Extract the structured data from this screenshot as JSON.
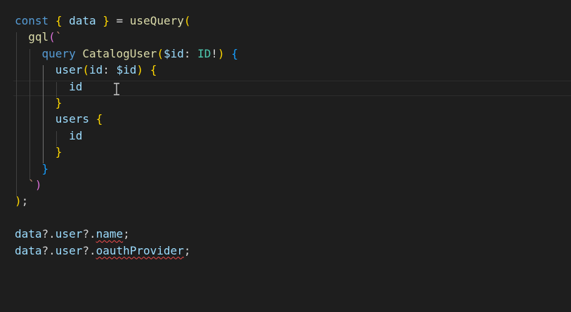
{
  "editor": {
    "language": "javascript",
    "theme": "dark",
    "colors": {
      "background": "#1e1e1e",
      "keyword": "#569cd6",
      "variable": "#9cdcfe",
      "function": "#dcdcaa",
      "type": "#4ec9b0",
      "bracket1": "#ffd700",
      "bracket2": "#da70d6",
      "bracket3": "#179fff",
      "punctuation": "#d4d4d4",
      "error_squiggle": "#f14c4c"
    },
    "cursor": {
      "icon": "text-cursor-ibeam-icon",
      "line": 5
    },
    "lines": [
      [
        [
          "const",
          "#569cd6"
        ],
        [
          " ",
          "#d4d4d4"
        ],
        [
          "{",
          "#ffd700"
        ],
        [
          " data ",
          "#9cdcfe"
        ],
        [
          "}",
          "#ffd700"
        ],
        [
          " = ",
          "#d4d4d4"
        ],
        [
          "useQuery",
          "#dcdcaa"
        ],
        [
          "(",
          "#ffd700"
        ]
      ],
      [
        [
          "  ",
          "#d4d4d4"
        ],
        [
          "gql",
          "#dcdcaa"
        ],
        [
          "(",
          "#da70d6"
        ],
        [
          "`",
          "#ce9178"
        ]
      ],
      [
        [
          "    ",
          "#d4d4d4"
        ],
        [
          "query",
          "#569cd6"
        ],
        [
          " ",
          "#d4d4d4"
        ],
        [
          "CatalogUser",
          "#dcdcaa"
        ],
        [
          "(",
          "#ffd700"
        ],
        [
          "$id",
          "#9cdcfe"
        ],
        [
          ": ",
          "#d4d4d4"
        ],
        [
          "ID",
          "#4ec9b0"
        ],
        [
          "!",
          "#d4d4d4"
        ],
        [
          ")",
          "#ffd700"
        ],
        [
          " ",
          "#d4d4d4"
        ],
        [
          "{",
          "#179fff"
        ]
      ],
      [
        [
          "      ",
          "#d4d4d4"
        ],
        [
          "user",
          "#9cdcfe"
        ],
        [
          "(",
          "#ffd700"
        ],
        [
          "id",
          "#9cdcfe"
        ],
        [
          ": ",
          "#d4d4d4"
        ],
        [
          "$id",
          "#9cdcfe"
        ],
        [
          ")",
          "#ffd700"
        ],
        [
          " ",
          "#d4d4d4"
        ],
        [
          "{",
          "#ffd700"
        ]
      ],
      [
        [
          "        ",
          "#d4d4d4"
        ],
        [
          "id",
          "#9cdcfe"
        ]
      ],
      [
        [
          "      ",
          "#d4d4d4"
        ],
        [
          "}",
          "#ffd700"
        ]
      ],
      [
        [
          "      ",
          "#d4d4d4"
        ],
        [
          "users",
          "#9cdcfe"
        ],
        [
          " ",
          "#d4d4d4"
        ],
        [
          "{",
          "#ffd700"
        ]
      ],
      [
        [
          "        ",
          "#d4d4d4"
        ],
        [
          "id",
          "#9cdcfe"
        ]
      ],
      [
        [
          "      ",
          "#d4d4d4"
        ],
        [
          "}",
          "#ffd700"
        ]
      ],
      [
        [
          "    ",
          "#d4d4d4"
        ],
        [
          "}",
          "#179fff"
        ]
      ],
      [
        [
          "  ",
          "#d4d4d4"
        ],
        [
          "`",
          "#ce9178"
        ],
        [
          ")",
          "#da70d6"
        ]
      ],
      [
        [
          ")",
          "#ffd700"
        ],
        [
          ";",
          "#d4d4d4"
        ]
      ],
      [],
      [
        [
          "data",
          "#9cdcfe"
        ],
        [
          "?.",
          "#d4d4d4"
        ],
        [
          "user",
          "#9cdcfe"
        ],
        [
          "?.",
          "#d4d4d4"
        ],
        [
          "name",
          "#9cdcfe",
          "squiggle"
        ],
        [
          ";",
          "#d4d4d4"
        ]
      ],
      [
        [
          "data",
          "#9cdcfe"
        ],
        [
          "?.",
          "#d4d4d4"
        ],
        [
          "user",
          "#9cdcfe"
        ],
        [
          "?.",
          "#d4d4d4"
        ],
        [
          "oauthProvider",
          "#9cdcfe",
          "squiggle"
        ],
        [
          ";",
          "#d4d4d4"
        ]
      ]
    ]
  }
}
